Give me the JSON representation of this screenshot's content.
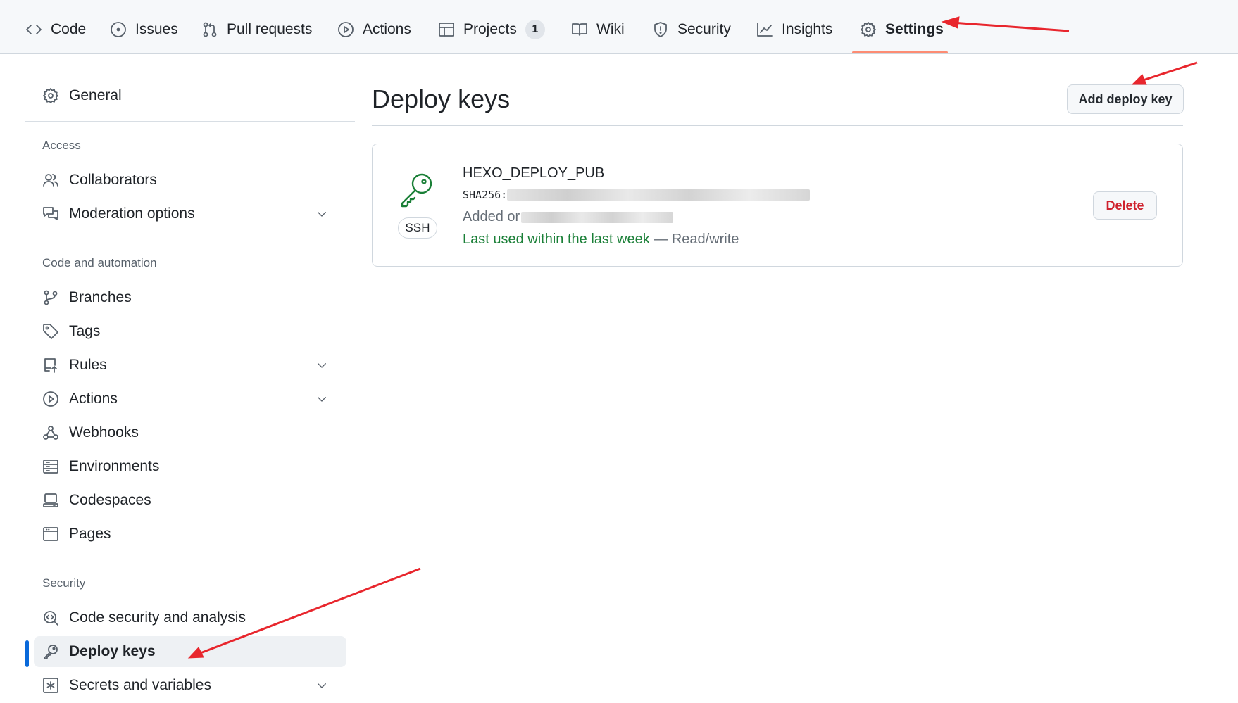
{
  "tabs": [
    {
      "label": "Code",
      "icon": "code-icon"
    },
    {
      "label": "Issues",
      "icon": "issue-opened-icon"
    },
    {
      "label": "Pull requests",
      "icon": "git-pull-request-icon"
    },
    {
      "label": "Actions",
      "icon": "play-icon"
    },
    {
      "label": "Projects",
      "icon": "table-icon",
      "count": "1"
    },
    {
      "label": "Wiki",
      "icon": "book-icon"
    },
    {
      "label": "Security",
      "icon": "shield-icon"
    },
    {
      "label": "Insights",
      "icon": "graph-icon"
    },
    {
      "label": "Settings",
      "icon": "gear-icon",
      "active": true
    }
  ],
  "sidebar": {
    "general": "General",
    "access_heading": "Access",
    "access_items": [
      "Collaborators",
      "Moderation options"
    ],
    "code_heading": "Code and automation",
    "code_items": [
      "Branches",
      "Tags",
      "Rules",
      "Actions",
      "Webhooks",
      "Environments",
      "Codespaces",
      "Pages"
    ],
    "security_heading": "Security",
    "security_items": [
      "Code security and analysis",
      "Deploy keys",
      "Secrets and variables"
    ]
  },
  "main": {
    "title": "Deploy keys",
    "add_button": "Add deploy key",
    "key": {
      "name": "HEXO_DEPLOY_PUB",
      "sha_prefix": "SHA256:",
      "added_prefix": "Added or",
      "type_badge": "SSH",
      "last_used": "Last used within the last week",
      "access": " — Read/write",
      "delete_button": "Delete"
    }
  },
  "colors": {
    "accent_blue": "#0969da",
    "tab_underline": "#fd8c73",
    "success_green": "#1a7f37",
    "danger_red": "#cf222e",
    "annotation_red": "#e8262d"
  }
}
